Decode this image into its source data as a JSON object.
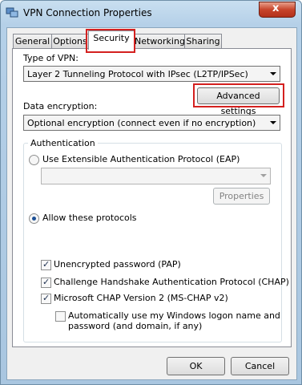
{
  "window": {
    "title": "VPN Connection Properties",
    "close_symbol": "x"
  },
  "tabs": [
    {
      "label": "General"
    },
    {
      "label": "Options"
    },
    {
      "label": "Security"
    },
    {
      "label": "Networking"
    },
    {
      "label": "Sharing"
    }
  ],
  "security": {
    "vpn_type_label": "Type of VPN:",
    "vpn_type_value": "Layer 2 Tunneling Protocol with IPsec (L2TP/IPSec)",
    "advanced_settings_label": "Advanced settings",
    "data_encryption_label": "Data encryption:",
    "data_encryption_value": "Optional encryption (connect even if no encryption)",
    "authentication_group_label": "Authentication",
    "eap_option_label": "Use Extensible Authentication Protocol (EAP)",
    "eap_dropdown_value": "",
    "properties_label": "Properties",
    "allow_protocols_label": "Allow these protocols",
    "protocols": {
      "pap_label": "Unencrypted password (PAP)",
      "chap_label": "Challenge Handshake Authentication Protocol (CHAP)",
      "mschap_label": "Microsoft CHAP Version 2 (MS-CHAP v2)",
      "auto_logon_line1": "Automatically use my Windows logon name and",
      "auto_logon_line2": "password (and domain, if any)"
    }
  },
  "footer": {
    "ok_label": "OK",
    "cancel_label": "Cancel"
  },
  "colors": {
    "highlight": "#d4201f",
    "radio_selected": "#1c4f95"
  }
}
